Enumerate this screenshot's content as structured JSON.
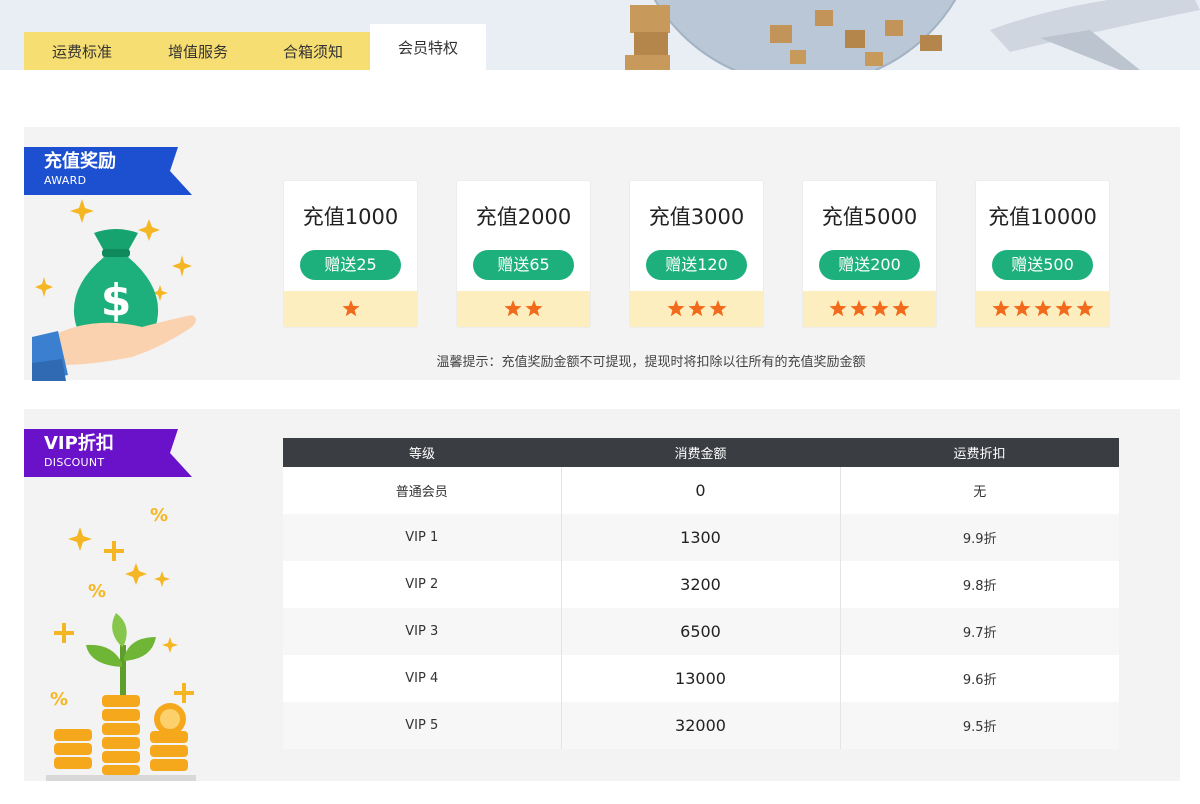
{
  "tabs": [
    {
      "label": "运费标准",
      "active": false
    },
    {
      "label": "增值服务",
      "active": false
    },
    {
      "label": "合箱须知",
      "active": false
    },
    {
      "label": "会员特权",
      "active": true
    }
  ],
  "award": {
    "title": "充值奖励",
    "subtitle": "AWARD",
    "ribbon_color": "#1d4fd1",
    "cards": [
      {
        "amount": "充值1000",
        "gift": "赠送25",
        "stars": 1
      },
      {
        "amount": "充值2000",
        "gift": "赠送65",
        "stars": 2
      },
      {
        "amount": "充值3000",
        "gift": "赠送120",
        "stars": 3
      },
      {
        "amount": "充值5000",
        "gift": "赠送200",
        "stars": 4
      },
      {
        "amount": "充值10000",
        "gift": "赠送500",
        "stars": 5
      }
    ],
    "tip": "温馨提示：充值奖励金额不可提现，提现时将扣除以往所有的充值奖励金额"
  },
  "vip": {
    "title": "VIP折扣",
    "subtitle": "DISCOUNT",
    "ribbon_color": "#6a12c9",
    "columns": [
      "等级",
      "消费金额",
      "运费折扣"
    ],
    "rows": [
      {
        "level": "普通会员",
        "amount": "0",
        "discount": "无"
      },
      {
        "level": "VIP 1",
        "amount": "1300",
        "discount": "9.9折"
      },
      {
        "level": "VIP 2",
        "amount": "3200",
        "discount": "9.8折"
      },
      {
        "level": "VIP 3",
        "amount": "6500",
        "discount": "9.7折"
      },
      {
        "level": "VIP 4",
        "amount": "13000",
        "discount": "9.6折"
      },
      {
        "level": "VIP 5",
        "amount": "32000",
        "discount": "9.5折"
      }
    ]
  },
  "colors": {
    "tab_bg": "#f7de73",
    "gift_green": "#1db07d",
    "star_orange": "#f26a1b",
    "stub_bg": "#fdeec0",
    "table_header": "#3a3d42"
  },
  "icons": [
    "money-bag-icon",
    "hand-icon",
    "sparkle-icon",
    "plant-icon",
    "coin-stack-icon",
    "percent-icon",
    "globe-illustration",
    "airplane-illustration"
  ]
}
